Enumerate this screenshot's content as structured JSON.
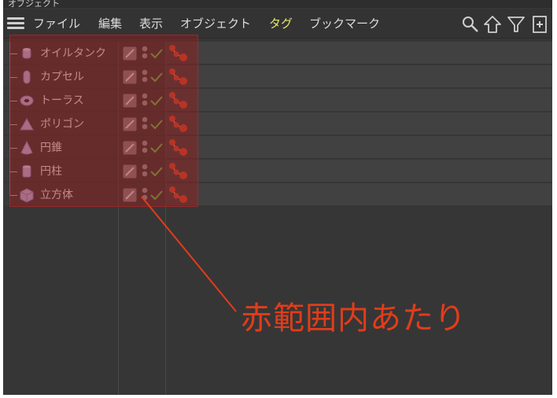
{
  "window": {
    "title": "オブジェクト"
  },
  "menu": {
    "items": [
      {
        "label": "ファイル",
        "active": false
      },
      {
        "label": "編集",
        "active": false
      },
      {
        "label": "表示",
        "active": false
      },
      {
        "label": "オブジェクト",
        "active": false
      },
      {
        "label": "タグ",
        "active": true
      },
      {
        "label": "ブックマーク",
        "active": false
      }
    ],
    "toolbar_icons": [
      "search-icon",
      "home-icon",
      "filter-icon",
      "new-window-icon"
    ]
  },
  "objects": [
    {
      "label": "オイルタンク",
      "icon": "oil-tank-icon"
    },
    {
      "label": "カプセル",
      "icon": "capsule-icon"
    },
    {
      "label": "トーラス",
      "icon": "torus-icon"
    },
    {
      "label": "ポリゴン",
      "icon": "polygon-icon"
    },
    {
      "label": "円錐",
      "icon": "cone-icon"
    },
    {
      "label": "円柱",
      "icon": "cylinder-icon"
    },
    {
      "label": "立方体",
      "icon": "cube-icon"
    }
  ],
  "annotation": {
    "text": "赤範囲内あたり"
  },
  "colors": {
    "highlight": "#961e1e",
    "annotation": "#e23c1a",
    "active_menu": "#e6e36c",
    "check": "#6ec04a",
    "tag_sphere": "#d8482a"
  }
}
